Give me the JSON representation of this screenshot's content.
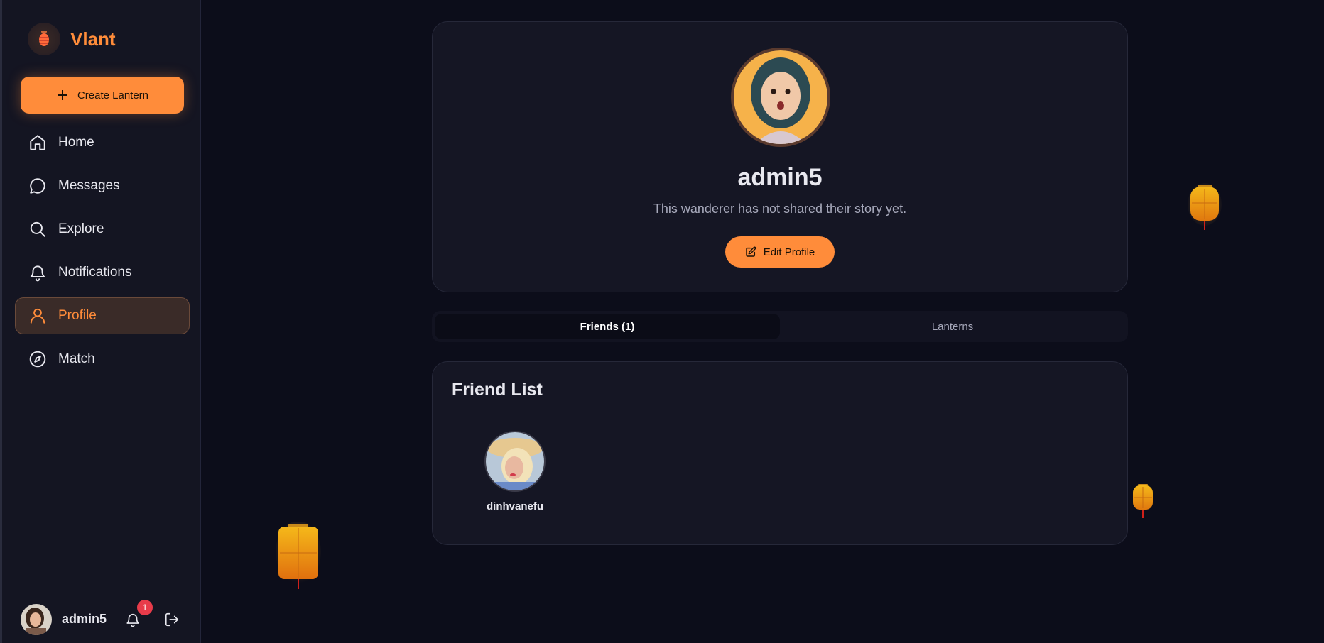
{
  "brand": {
    "name": "Vlant"
  },
  "sidebar": {
    "create_label": "Create Lantern",
    "items": [
      {
        "label": "Home"
      },
      {
        "label": "Messages"
      },
      {
        "label": "Explore"
      },
      {
        "label": "Notifications"
      },
      {
        "label": "Profile"
      },
      {
        "label": "Match"
      }
    ],
    "footer": {
      "username": "admin5",
      "notification_count": "1"
    }
  },
  "profile": {
    "username": "admin5",
    "bio": "This wanderer has not shared their story yet.",
    "edit_label": "Edit Profile"
  },
  "tabs": [
    {
      "label": "Friends (1)"
    },
    {
      "label": "Lanterns"
    }
  ],
  "friends": {
    "title": "Friend List",
    "items": [
      {
        "name": "dinhvanefu"
      }
    ]
  },
  "colors": {
    "accent": "#ff8c3a",
    "background": "#0c0d1a",
    "sidebar": "#141522",
    "card": "#151624",
    "badge": "#e83b4a"
  },
  "icons": {
    "brand": "lantern-icon",
    "create": "plus-icon",
    "home": "home-icon",
    "messages": "chat-bubble-icon",
    "explore": "search-icon",
    "notifications": "bell-icon",
    "profile": "user-icon",
    "match": "compass-icon",
    "edit": "edit-icon",
    "logout": "logout-icon"
  }
}
